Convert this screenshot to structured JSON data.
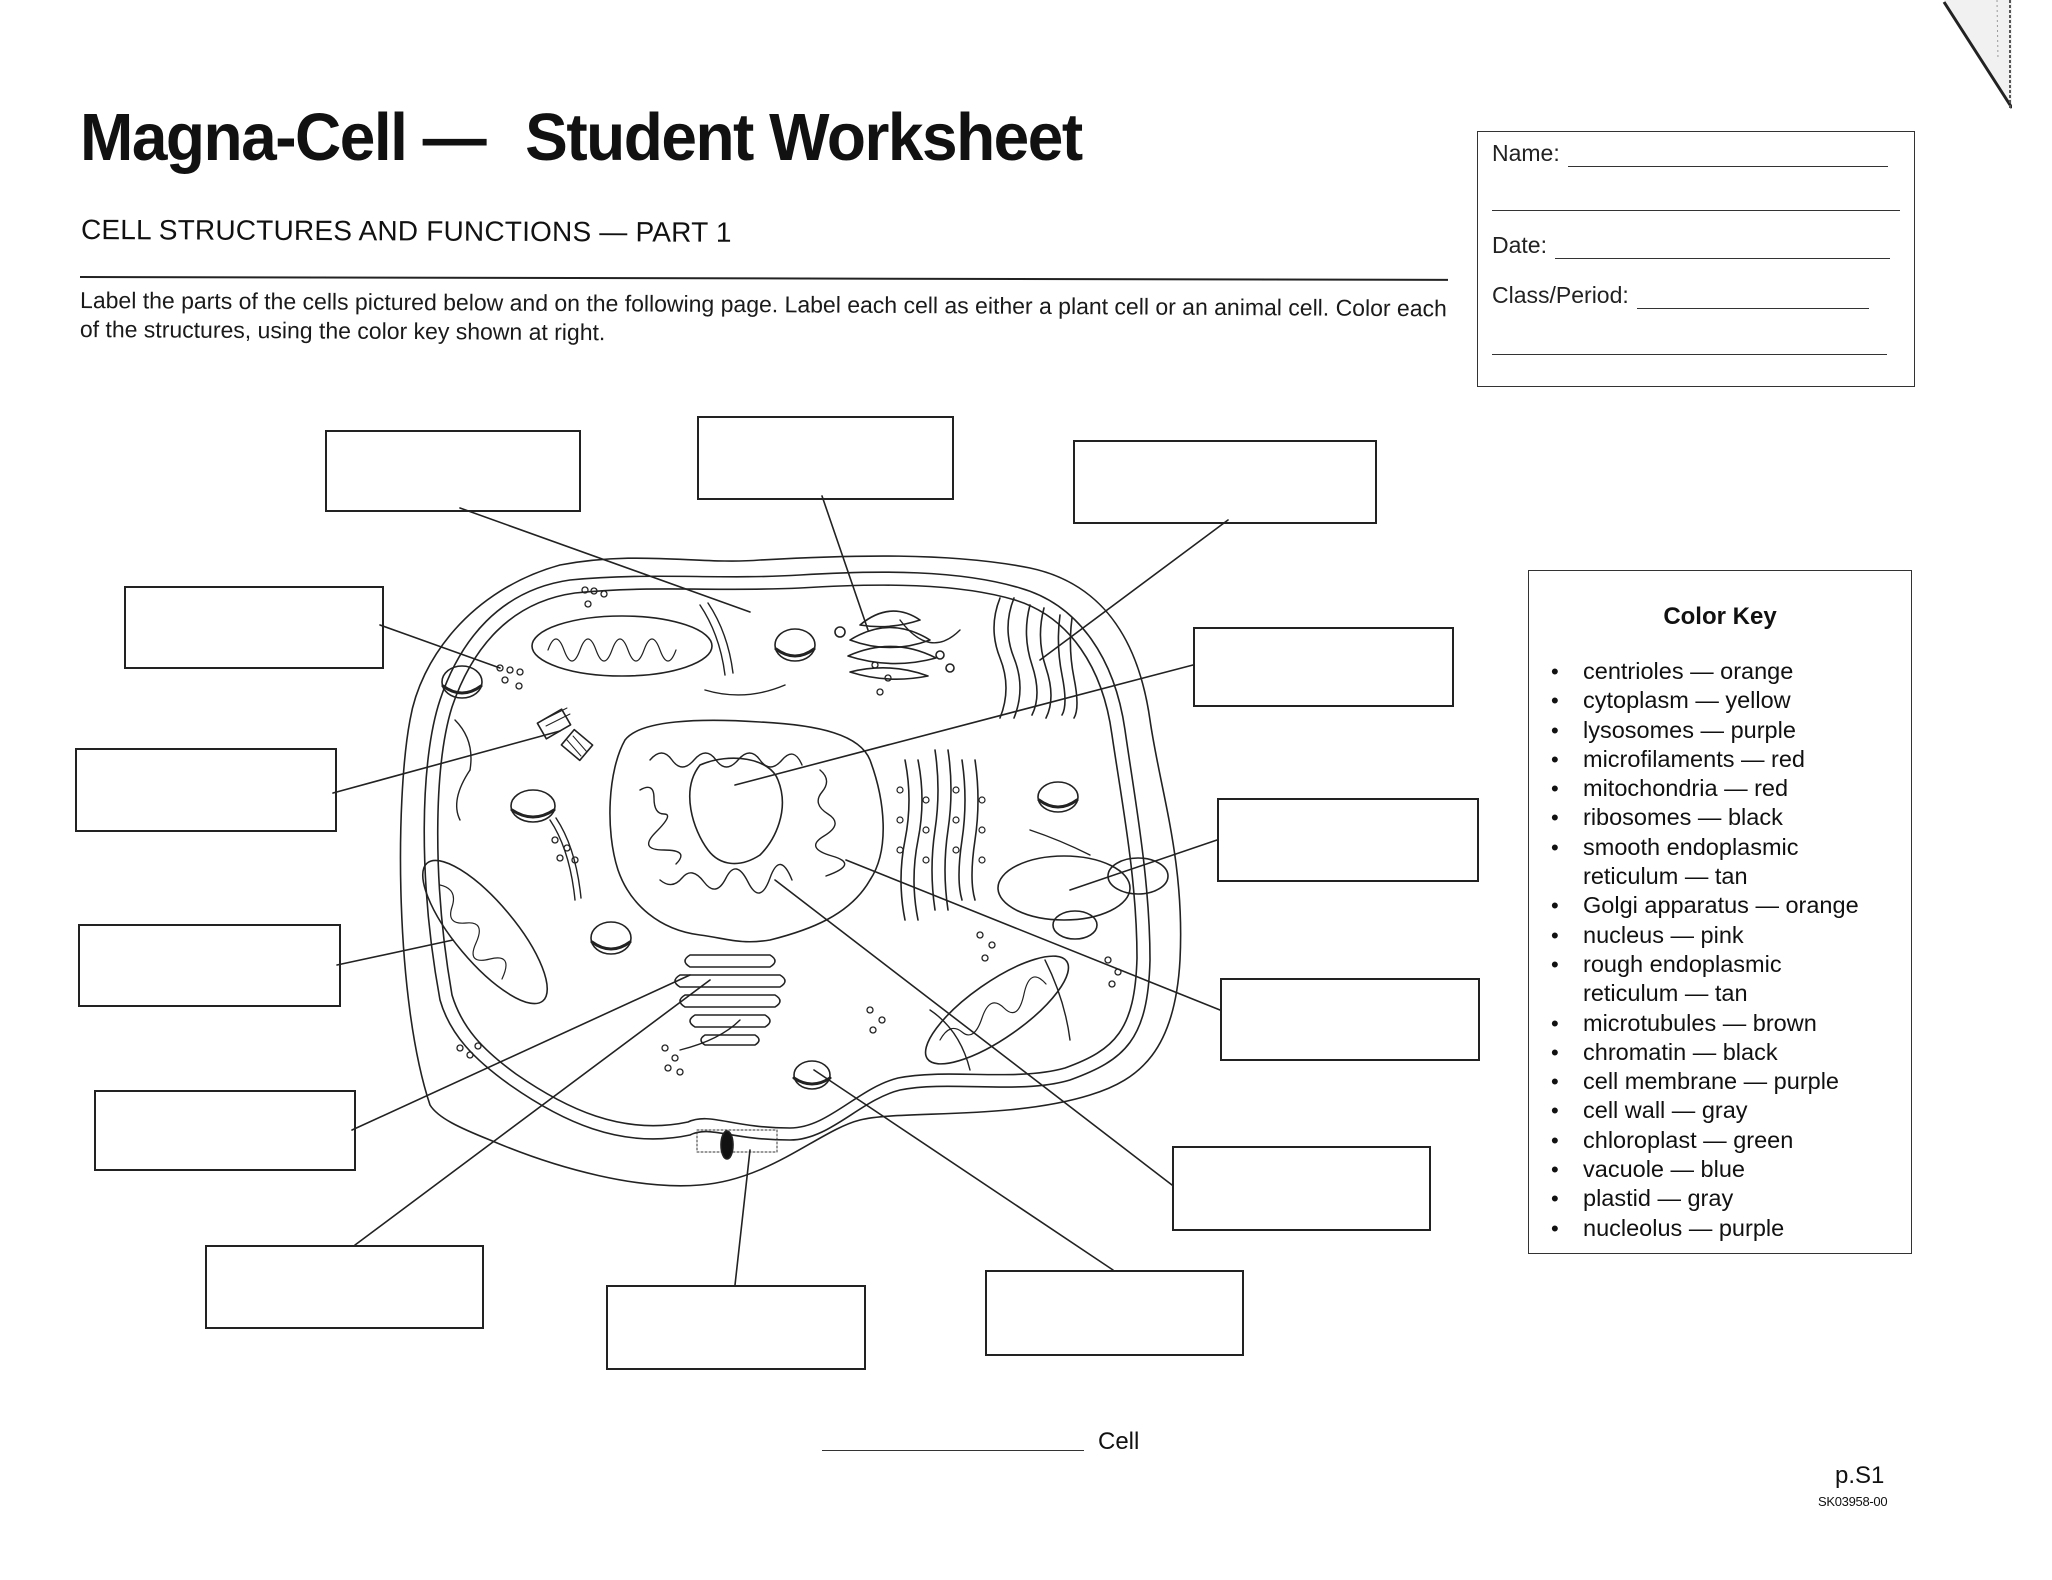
{
  "header": {
    "title_part1": "Magna-Cell —",
    "title_part2": "Student Worksheet",
    "subtitle": "CELL STRUCTURES AND FUNCTIONS — PART 1",
    "instructions": "Label the parts of the cells pictured below and on the following page. Label each cell as either a plant cell or an animal cell. Color each of the structures, using the color key shown at right."
  },
  "student_info": {
    "name_label": "Name:",
    "name_value": "",
    "date_label": "Date:",
    "date_value": "",
    "class_label": "Class/Period:",
    "class_value": ""
  },
  "color_key": {
    "title": "Color Key",
    "items": [
      {
        "text": "centrioles — orange"
      },
      {
        "text": "cytoplasm — yellow"
      },
      {
        "text": "lysosomes — purple"
      },
      {
        "text": "microfilaments — red"
      },
      {
        "text": "mitochondria — red"
      },
      {
        "text": "ribosomes — black"
      },
      {
        "line1": "smooth endoplasmic",
        "line2": "reticulum — tan"
      },
      {
        "text": "Golgi apparatus — orange"
      },
      {
        "text": "nucleus — pink"
      },
      {
        "line1": "rough endoplasmic",
        "line2": "reticulum — tan"
      },
      {
        "text": "microtubules — brown"
      },
      {
        "text": "chromatin — black"
      },
      {
        "text": "cell membrane — purple"
      },
      {
        "text": "cell wall — gray"
      },
      {
        "text": "chloroplast — green"
      },
      {
        "text": "vacuole — blue"
      },
      {
        "text": "plastid — gray"
      },
      {
        "text": "nucleolus — purple"
      }
    ]
  },
  "diagram": {
    "label_boxes": [
      "",
      "",
      "",
      "",
      "",
      "",
      "",
      "",
      "",
      "",
      "",
      "",
      "",
      ""
    ],
    "cell_type_value": "",
    "cell_type_suffix": "Cell"
  },
  "footer": {
    "page": "p.S1",
    "code": "SK03958-00"
  }
}
